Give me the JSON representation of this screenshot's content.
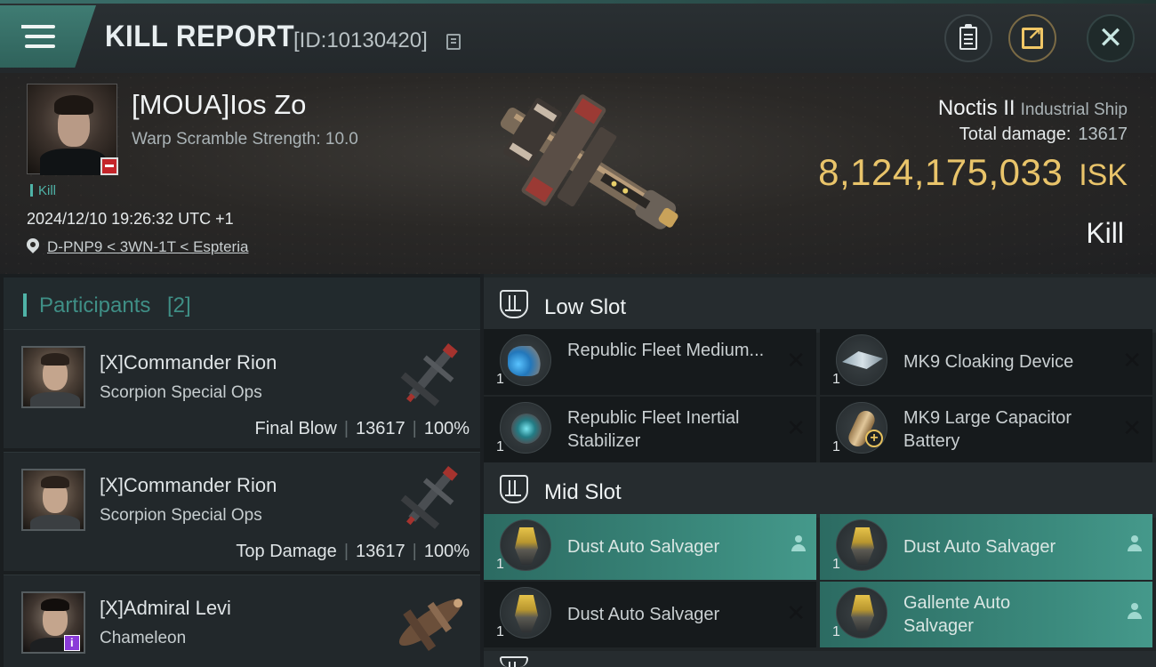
{
  "header": {
    "title": "KILL REPORT",
    "kill_id": "[ID:10130420]"
  },
  "victim": {
    "name": "[MOUA]Ios Zo",
    "warp_scramble": "Warp Scramble Strength: 10.0",
    "kill_tag": "Kill",
    "timestamp": "2024/12/10 19:26:32 UTC +1",
    "location": "D-PNP9 < 3WN-1T < Espteria",
    "ship_name": "Noctis II",
    "ship_class": "Industrial Ship",
    "total_damage_label": "Total damage:",
    "total_damage": "13617",
    "isk_value": "8,124,175,033",
    "isk_unit": "ISK",
    "result": "Kill"
  },
  "participants": {
    "title": "Participants",
    "count": "[2]",
    "items": [
      {
        "name": "[X]Commander Rion",
        "ship": "Scorpion Special Ops",
        "role": "Final Blow",
        "damage": "13617",
        "percent": "100%"
      },
      {
        "name": "[X]Commander Rion",
        "ship": "Scorpion Special Ops",
        "role": "Top Damage",
        "damage": "13617",
        "percent": "100%"
      },
      {
        "name": "[X]Admiral Levi",
        "ship": "Chameleon"
      }
    ]
  },
  "fitting": {
    "low_slot_label": "Low Slot",
    "mid_slot_label": "Mid Slot",
    "low": [
      {
        "name": "Republic Fleet Medium...",
        "qty": "1",
        "icon": "propulsion-module-icon",
        "status": "destroyed"
      },
      {
        "name": "MK9 Cloaking Device",
        "qty": "1",
        "icon": "cloaking-device-icon",
        "status": "destroyed"
      },
      {
        "name": "Republic Fleet Inertial Stabilizer",
        "qty": "1",
        "icon": "inertial-stabilizer-icon",
        "status": "destroyed"
      },
      {
        "name": "MK9 Large Capacitor Battery",
        "qty": "1",
        "icon": "capacitor-battery-icon",
        "status": "destroyed"
      }
    ],
    "mid": [
      {
        "name": "Dust Auto Salvager",
        "qty": "1",
        "icon": "salvager-icon",
        "status": "dropped"
      },
      {
        "name": "Dust Auto Salvager",
        "qty": "1",
        "icon": "salvager-icon",
        "status": "dropped"
      },
      {
        "name": "Dust Auto Salvager",
        "qty": "1",
        "icon": "salvager-icon",
        "status": "destroyed"
      },
      {
        "name": "Gallente Auto Salvager",
        "qty": "1",
        "icon": "salvager-icon",
        "status": "dropped"
      }
    ],
    "status_symbols": {
      "destroyed": "✕"
    }
  },
  "colors": {
    "accent": "#4fb3a7",
    "isk_gold": "#e9c46a",
    "dropped_row": "#3b8a7d",
    "destroyed_row": "#161a1c",
    "corp_badge": "#c4252a",
    "alpha_badge": "#8a3ad8"
  }
}
